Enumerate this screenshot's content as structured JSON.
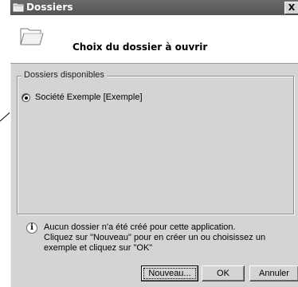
{
  "window": {
    "title": "Dossiers",
    "close_glyph": "X"
  },
  "header": {
    "title": "Choix du dossier à ouvrir",
    "icon": "open-folder-icon"
  },
  "group": {
    "legend": "Dossiers disponibles",
    "items": [
      {
        "label": "Société Exemple [Exemple]",
        "selected": true
      }
    ]
  },
  "info": {
    "icon": "info-icon",
    "glyph": "i",
    "lines": [
      "Aucun dossier n'a été créé pour cette application.",
      "Cliquez sur \"Nouveau\" pour en créer un ou choisissez un",
      "exemple et cliquez sur \"OK\""
    ]
  },
  "buttons": {
    "nouveau": "Nouveau...",
    "ok": "OK",
    "annuler": "Annuler"
  }
}
